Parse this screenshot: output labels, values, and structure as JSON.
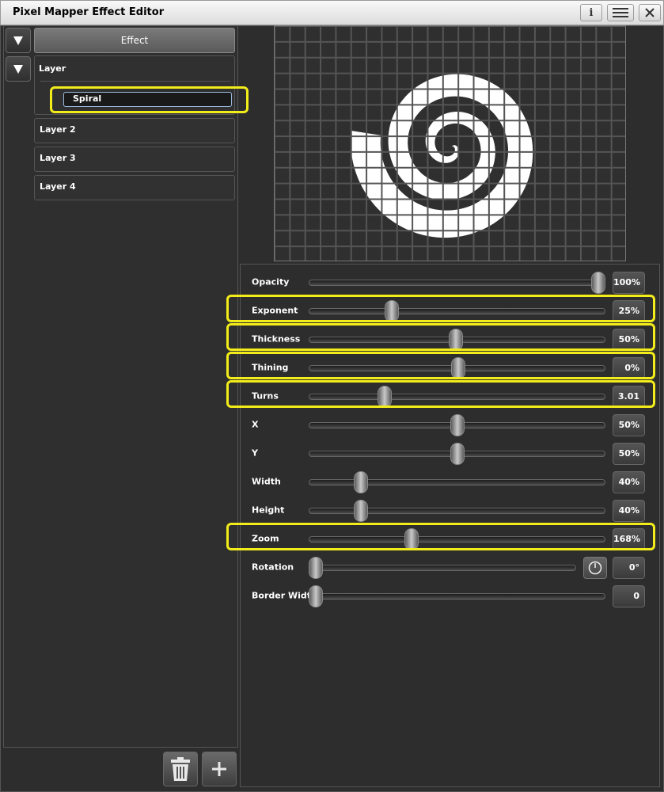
{
  "window": {
    "title": "Pixel Mapper Effect Editor",
    "buttons": [
      "info-icon",
      "menu-icon",
      "close-icon"
    ]
  },
  "tree": {
    "effect_label": "Effect",
    "layer_label": "Layer",
    "selected_shape": "Spiral",
    "layers": [
      "Layer 2",
      "Layer 3",
      "Layer 4"
    ]
  },
  "bottom_buttons": [
    "trash-icon",
    "plus-icon"
  ],
  "preview": {
    "grid_cols": 23,
    "grid_rows": 15,
    "shape": "spiral"
  },
  "properties": [
    {
      "label": "Opacity",
      "value": "100%",
      "level": 1.0,
      "highlight": false
    },
    {
      "label": "Exponent",
      "value": "25%",
      "level": 0.27,
      "highlight": true
    },
    {
      "label": "Thickness",
      "value": "50%",
      "level": 0.497,
      "highlight": true
    },
    {
      "label": "Thining",
      "value": "0%",
      "level": 0.503,
      "highlight": true
    },
    {
      "label": "Turns",
      "value": "3.01",
      "level": 0.243,
      "highlight": true
    },
    {
      "label": "X",
      "value": "50%",
      "level": 0.5,
      "highlight": false
    },
    {
      "label": "Y",
      "value": "50%",
      "level": 0.5,
      "highlight": false
    },
    {
      "label": "Width",
      "value": "40%",
      "level": 0.16,
      "highlight": false
    },
    {
      "label": "Height",
      "value": "40%",
      "level": 0.16,
      "highlight": false
    },
    {
      "label": "Zoom",
      "value": "168%",
      "level": 0.34,
      "highlight": true
    },
    {
      "label": "Rotation",
      "value": "0°",
      "level": 0.0,
      "highlight": false,
      "clock": true
    },
    {
      "label": "Border Width",
      "value": "0",
      "level": 0.0,
      "highlight": false
    }
  ],
  "colors": {
    "highlight": "#f2ec1a",
    "background": "#2d2d2d",
    "preview_fill": "#ffffff"
  }
}
